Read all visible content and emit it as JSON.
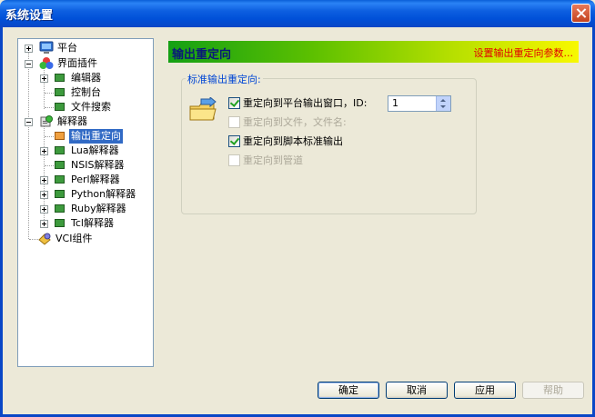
{
  "window": {
    "title": "系统设置"
  },
  "tree": {
    "items": [
      {
        "label": "平台"
      },
      {
        "label": "界面插件"
      },
      {
        "label": "编辑器"
      },
      {
        "label": "控制台"
      },
      {
        "label": "文件搜索"
      },
      {
        "label": "解释器"
      },
      {
        "label": "输出重定向"
      },
      {
        "label": "Lua解释器"
      },
      {
        "label": "NSIS解释器"
      },
      {
        "label": "Perl解释器"
      },
      {
        "label": "Python解释器"
      },
      {
        "label": "Ruby解释器"
      },
      {
        "label": "Tcl解释器"
      },
      {
        "label": "VCI组件"
      }
    ]
  },
  "panel": {
    "title": "输出重定向",
    "description": "设置输出重定向参数...",
    "group_label": "标准输出重定向:",
    "options": [
      {
        "label": "重定向到平台输出窗口，ID:",
        "checked": true,
        "enabled": true
      },
      {
        "label": "重定向到文件，文件名:",
        "checked": false,
        "enabled": false
      },
      {
        "label": "重定向到脚本标准输出",
        "checked": true,
        "enabled": true
      },
      {
        "label": "重定向到管道",
        "checked": false,
        "enabled": false
      }
    ],
    "id_value": "1"
  },
  "buttons": {
    "ok": "确定",
    "cancel": "取消",
    "apply": "应用",
    "help": "帮助"
  }
}
